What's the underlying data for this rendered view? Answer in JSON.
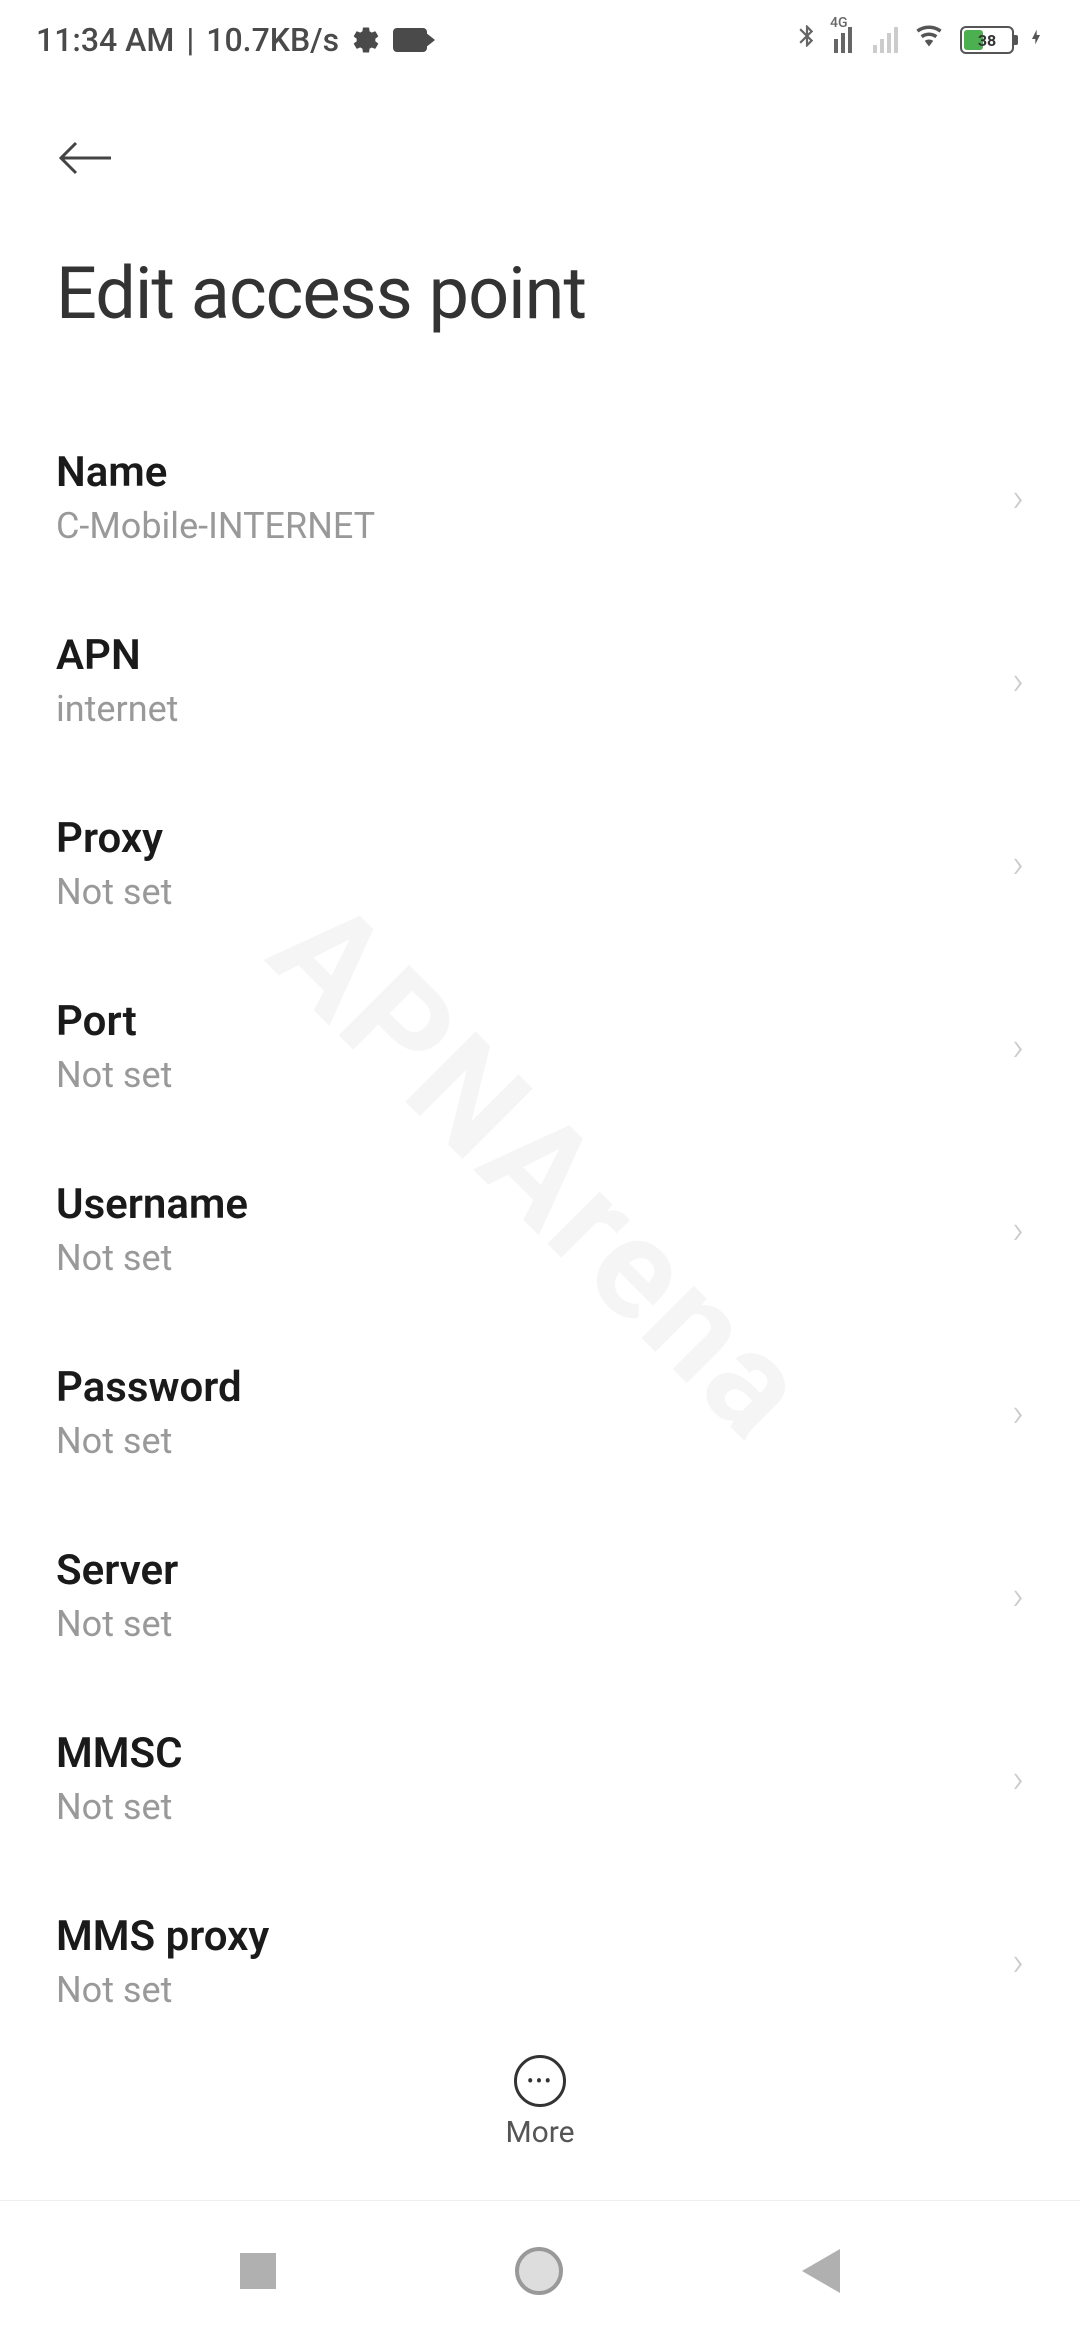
{
  "statusBar": {
    "time": "11:34 AM",
    "dataRate": "10.7KB/s",
    "networkLabel": "4G",
    "batteryPercent": "38"
  },
  "page": {
    "title": "Edit access point"
  },
  "settings": [
    {
      "label": "Name",
      "value": "C-Mobile-INTERNET"
    },
    {
      "label": "APN",
      "value": "internet"
    },
    {
      "label": "Proxy",
      "value": "Not set"
    },
    {
      "label": "Port",
      "value": "Not set"
    },
    {
      "label": "Username",
      "value": "Not set"
    },
    {
      "label": "Password",
      "value": "Not set"
    },
    {
      "label": "Server",
      "value": "Not set"
    },
    {
      "label": "MMSC",
      "value": "Not set"
    },
    {
      "label": "MMS proxy",
      "value": "Not set"
    }
  ],
  "toolbar": {
    "moreLabel": "More"
  },
  "watermark": "APNArena"
}
